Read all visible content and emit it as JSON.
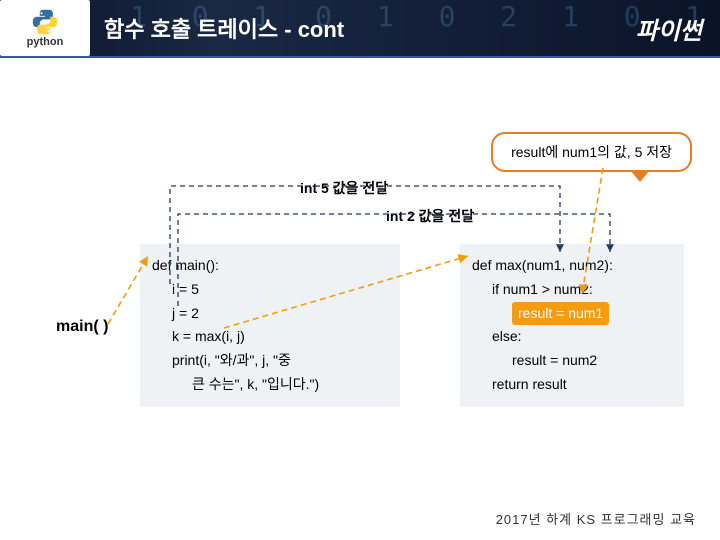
{
  "header": {
    "title": "함수 호출 트레이스 - cont",
    "logo_text": "python",
    "brand": "파이썬",
    "bg_digits": "1 0 1 0 1 0 2 1 0 1 0 1"
  },
  "callout": "result에 num1의 값, 5 저장",
  "labels": {
    "int5": "int 5 값을 전달",
    "int2": "int 2 값을 전달"
  },
  "main_call": "main( )",
  "code_main": {
    "def": "def main():",
    "l1": "i = 5",
    "l2": "j = 2",
    "l3": "k = max(i, j)",
    "l4": "print(i, \"와/과\", j, \"중",
    "l5": "  큰 수는\", k, \"입니다.\")"
  },
  "code_max": {
    "def": "def max(num1, num2):",
    "l1": "if num1 > num2:",
    "l2": "result = num1",
    "l3": "else:",
    "l4": "result = num2",
    "l5": "return result"
  },
  "footer": "2017년  하계  KS  프로그래밍  교육"
}
